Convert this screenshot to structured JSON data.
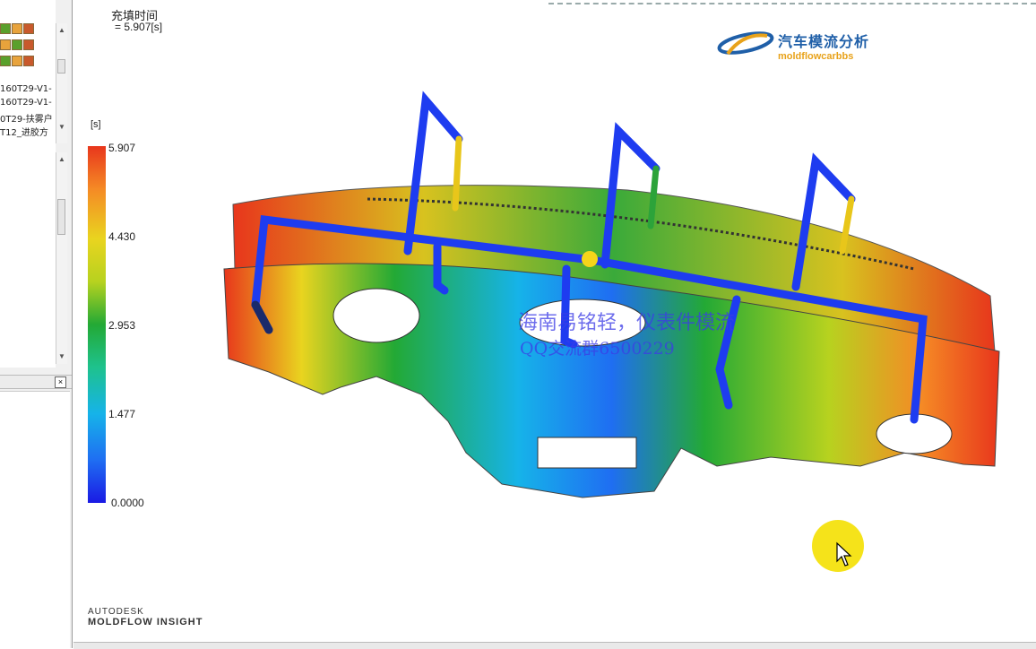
{
  "left_panel": {
    "tree_items": [
      "160T29-V1-",
      "160T29-V1-",
      "0T29-扶雾户",
      "T12_进胶方"
    ],
    "close_glyph": "×"
  },
  "result": {
    "title": "充填时间",
    "value": "= 5.907[s]"
  },
  "logo": {
    "cn": "汽车模流分析",
    "en": "moldflowcarbbs"
  },
  "legend": {
    "unit": "[s]",
    "ticks": [
      "5.907",
      "4.430",
      "2.953",
      "1.477",
      "0.0000"
    ],
    "colors": [
      "#e8361c",
      "#e9d41f",
      "#23a935",
      "#16b3e9",
      "#1a1ae4"
    ]
  },
  "brand": {
    "line1": "AUTODESK",
    "line2": "MOLDFLOW INSIGHT"
  },
  "watermark": {
    "line1": "海南易铭轻，仪表件模流",
    "line2": "QQ交流群6500229"
  },
  "icons": [
    "tree-node-icon",
    "cursor-arrow-icon",
    "gate-marker-icon"
  ]
}
